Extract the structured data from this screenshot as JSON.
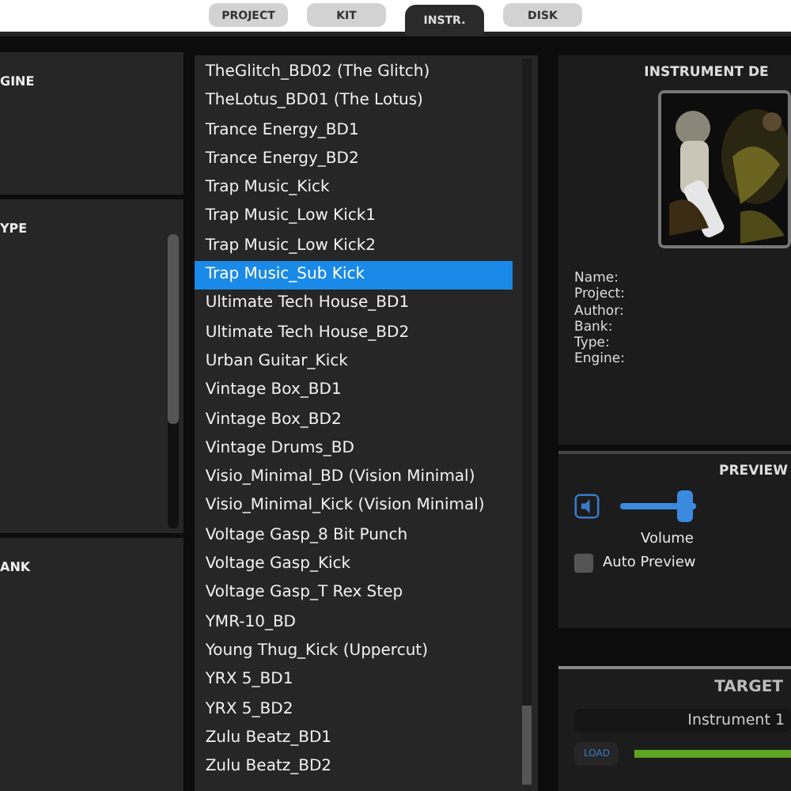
{
  "tabs": [
    {
      "label": "PROJECT",
      "selected": false
    },
    {
      "label": "KIT",
      "selected": false
    },
    {
      "label": "INSTR.",
      "selected": true
    },
    {
      "label": "DISK",
      "selected": false
    }
  ],
  "left_sections": [
    {
      "title": "GINE",
      "scrollbar": false
    },
    {
      "title": "YPE",
      "scrollbar": true
    },
    {
      "title": "ANK",
      "scrollbar": false
    }
  ],
  "instrument_list": [
    {
      "name": "TheGlitch_BD02 (The Glitch)",
      "selected": false
    },
    {
      "name": "TheLotus_BD01 (The Lotus)",
      "selected": false
    },
    {
      "name": "Trance Energy_BD1",
      "selected": false
    },
    {
      "name": "Trance Energy_BD2",
      "selected": false
    },
    {
      "name": "Trap Music_Kick",
      "selected": false
    },
    {
      "name": "Trap Music_Low Kick1",
      "selected": false
    },
    {
      "name": "Trap Music_Low Kick2",
      "selected": false
    },
    {
      "name": "Trap Music_Sub Kick",
      "selected": true
    },
    {
      "name": "Ultimate Tech House_BD1",
      "selected": false
    },
    {
      "name": "Ultimate Tech House_BD2",
      "selected": false
    },
    {
      "name": "Urban Guitar_Kick",
      "selected": false
    },
    {
      "name": "Vintage Box_BD1",
      "selected": false
    },
    {
      "name": "Vintage Box_BD2",
      "selected": false
    },
    {
      "name": "Vintage Drums_BD",
      "selected": false
    },
    {
      "name": "Visio_Minimal_BD (Vision Minimal)",
      "selected": false
    },
    {
      "name": "Visio_Minimal_Kick (Vision Minimal)",
      "selected": false
    },
    {
      "name": "Voltage Gasp_8 Bit Punch",
      "selected": false
    },
    {
      "name": "Voltage Gasp_Kick",
      "selected": false
    },
    {
      "name": "Voltage Gasp_T Rex Step",
      "selected": false
    },
    {
      "name": "YMR-10_BD",
      "selected": false
    },
    {
      "name": "Young Thug_Kick (Uppercut)",
      "selected": false
    },
    {
      "name": "YRX 5_BD1",
      "selected": false
    },
    {
      "name": "YRX 5_BD2",
      "selected": false
    },
    {
      "name": "Zulu Beatz_BD1",
      "selected": false
    },
    {
      "name": "Zulu Beatz_BD2",
      "selected": false
    }
  ],
  "details": {
    "title": "INSTRUMENT DE",
    "fields": [
      "Name:",
      "Project:",
      "Author:",
      "Bank:",
      "Type:",
      "Engine:"
    ]
  },
  "preview": {
    "title": "PREVIEW",
    "volume": {
      "label": "Volume",
      "level": 0.8
    },
    "auto_preview": {
      "label": "Auto Preview",
      "checked": false
    }
  },
  "target": {
    "title": "TARGET",
    "field": "Instrument 1",
    "load_button": "LOAD",
    "progress": {
      "level": 1
    }
  }
}
